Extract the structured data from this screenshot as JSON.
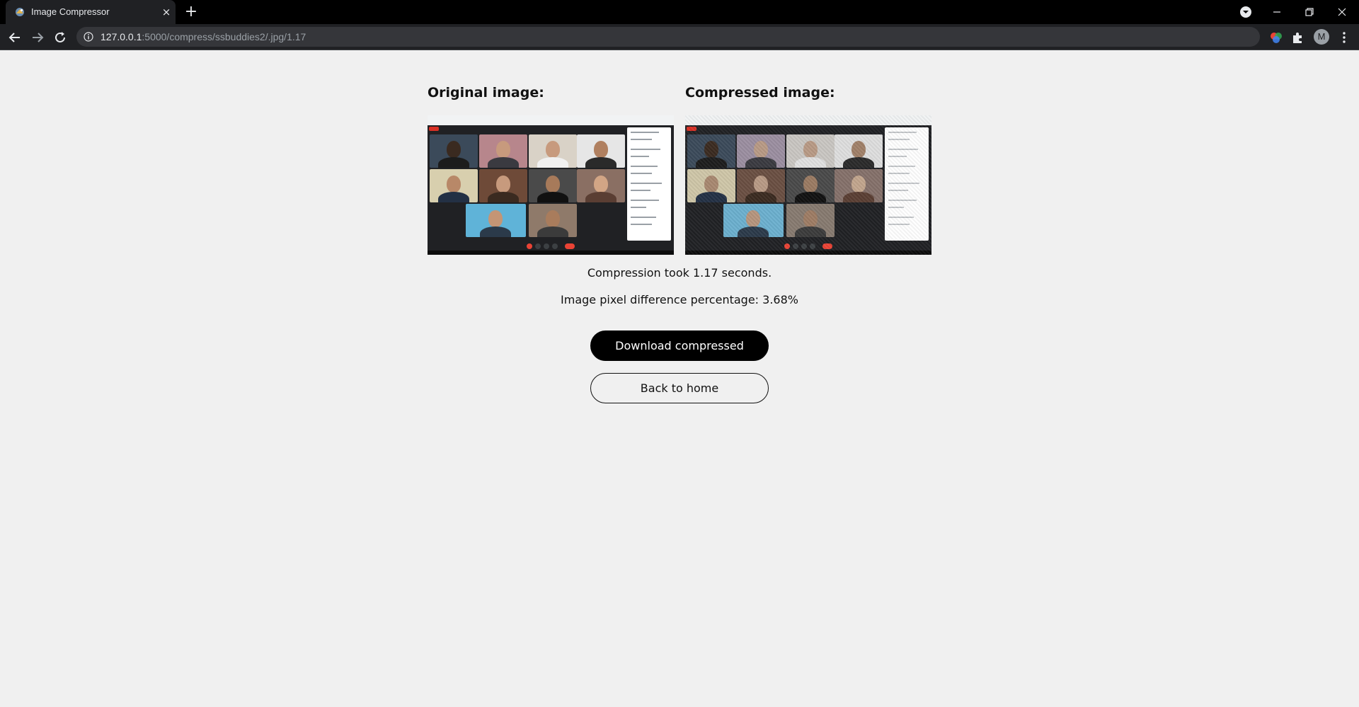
{
  "browser": {
    "tab_title": "Image Compressor",
    "tab_close": "×",
    "new_tab": "+",
    "url_host": "127.0.0.1",
    "url_rest": ":5000/compress/ssbuddies2/.jpg/1.17",
    "avatar_letter": "M"
  },
  "page": {
    "original_heading": "Original image:",
    "compressed_heading": "Compressed image:",
    "compression_time": "Compression took 1.17 seconds.",
    "pixel_difference": "Image pixel difference percentage: 3.68%",
    "download_label": "Download compressed",
    "home_label": "Back to home"
  },
  "colors": {
    "primary_button": "#000000",
    "page_background": "#f0f0f0",
    "chrome_dark": "#202124"
  }
}
